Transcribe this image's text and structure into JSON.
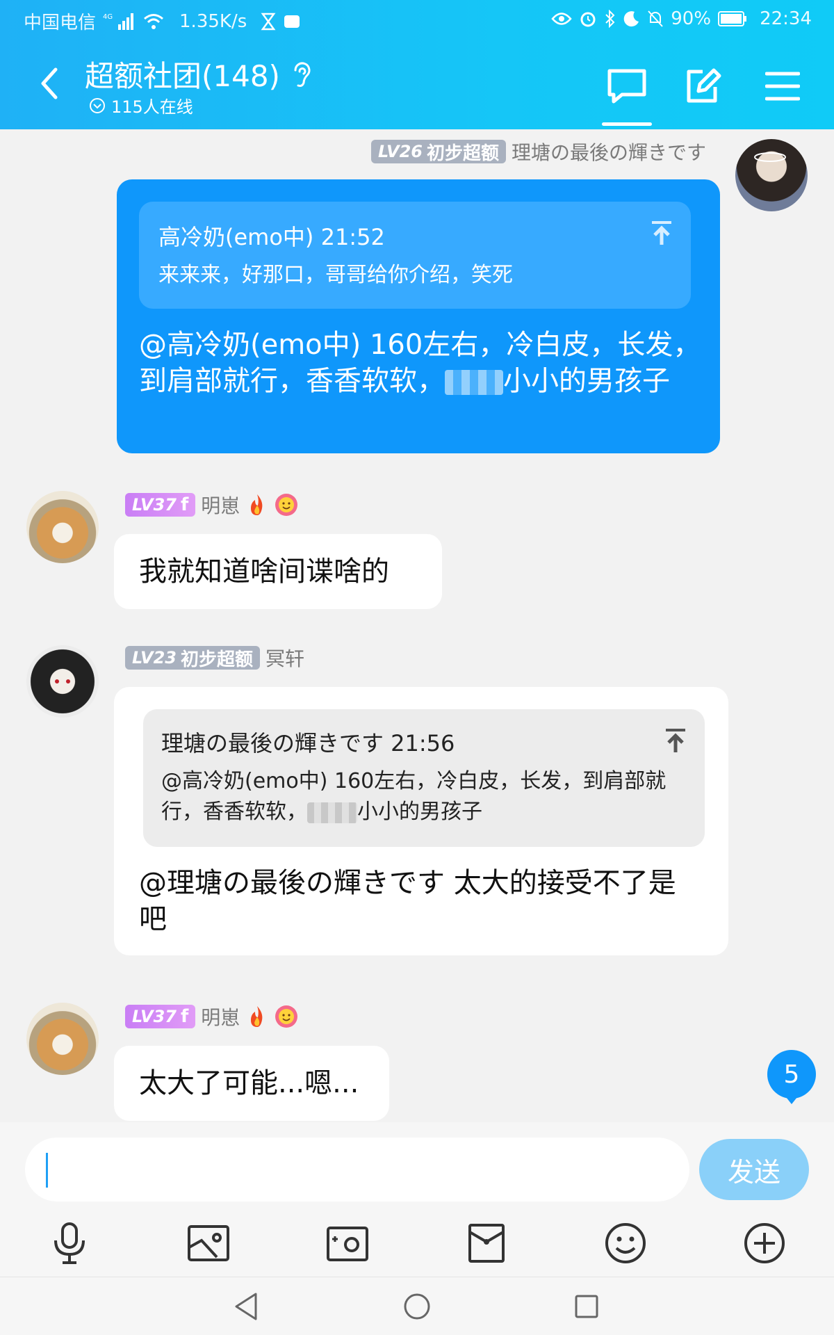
{
  "status_bar": {
    "carrier": "中国电信",
    "network": "4G",
    "speed": "1.35K/s",
    "battery": "90%",
    "time": "22:34"
  },
  "header": {
    "title": "超额社团(148)",
    "online": "115人在线",
    "icons": [
      "back-icon",
      "ear-icon",
      "chat-icon",
      "edit-icon",
      "menu-icon"
    ]
  },
  "messages": [
    {
      "sender": "理塘の最後の輝きです",
      "level": "LV26",
      "tag": "初步超额",
      "side": "right",
      "quote": {
        "header": "高冷奶(emo中) 21:52",
        "body": "来来来，好那口，哥哥给你介绍，笑死"
      },
      "text_before": "@高冷奶(emo中) 160左右，冷白皮，长发，到肩部就行，香香软软，",
      "text_after": "小小的男孩子"
    },
    {
      "sender": "明崽",
      "level": "LV37",
      "tag": "f",
      "side": "left",
      "text": "我就知道啥间谍啥的"
    },
    {
      "sender": "冥轩",
      "level": "LV23",
      "tag": "初步超额",
      "side": "left",
      "quote": {
        "header": "理塘の最後の輝きです 21:56",
        "body_before": "@高冷奶(emo中) 160左右，冷白皮，长发，到肩部就行，香香软软，",
        "body_after": "小小的男孩子"
      },
      "text": "@理塘の最後の輝きです 太大的接受不了是吧"
    },
    {
      "sender": "明崽",
      "level": "LV37",
      "tag": "f",
      "side": "left",
      "text": "太大了可能...嗯..."
    }
  ],
  "unread_count": "5",
  "input": {
    "placeholder": "",
    "value": "",
    "send_label": "发送"
  },
  "toolbar": [
    "microphone-icon",
    "image-icon",
    "camera-icon",
    "red-packet-icon",
    "emoji-icon",
    "plus-icon"
  ],
  "nav": [
    "back-triangle-icon",
    "home-circle-icon",
    "recents-square-icon"
  ],
  "colors": {
    "header": "#15c6f7",
    "bubble_blue": "#0f97fb",
    "send_button": "#8ad0f9"
  }
}
